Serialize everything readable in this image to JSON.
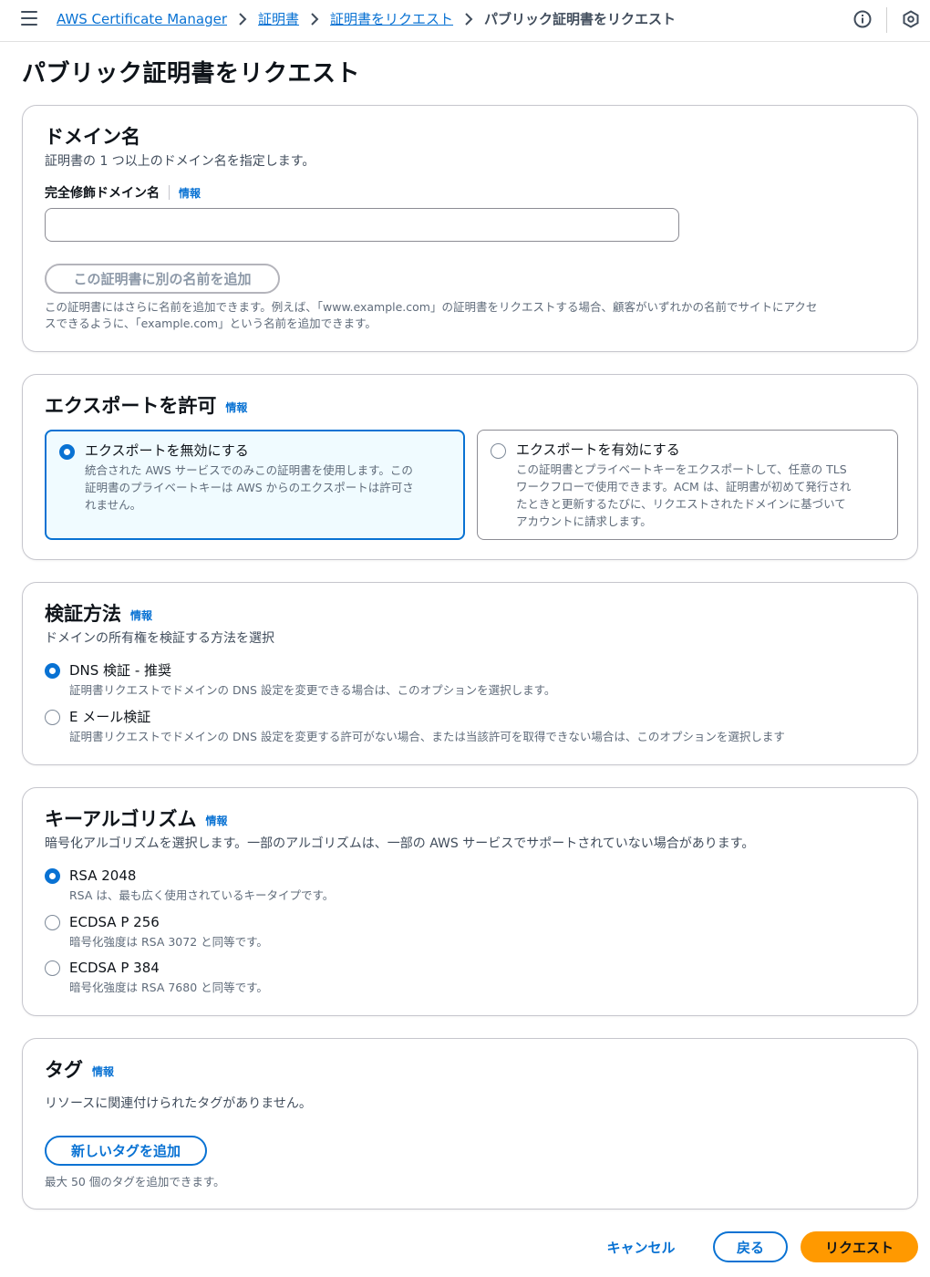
{
  "breadcrumbs": {
    "service": "AWS Certificate Manager",
    "certificates": "証明書",
    "request": "証明書をリクエスト",
    "current": "パブリック証明書をリクエスト"
  },
  "page": {
    "title": "パブリック証明書をリクエスト"
  },
  "info_label": "情報",
  "domain": {
    "title": "ドメイン名",
    "description": "証明書の 1 つ以上のドメイン名を指定します。",
    "field_label": "完全修飾ドメイン名",
    "field_value": "",
    "add_name_button": "この証明書に別の名前を追加",
    "help_line1": "この証明書にはさらに名前を追加できます。例えば、「www.example.com」の証明書をリクエストする場合、顧客がいずれかの名前でサイトにアクセ",
    "help_line2": "スできるように、「example.com」という名前を追加できます。"
  },
  "export": {
    "title": "エクスポートを許可",
    "options": [
      {
        "title": "エクスポートを無効にする",
        "desc_lines": [
          "統合された AWS サービスでのみこの証明書を使用します。この",
          "証明書のプライベートキーは AWS からのエクスポートは許可さ",
          "れません。"
        ],
        "selected": true
      },
      {
        "title": "エクスポートを有効にする",
        "desc_lines": [
          "この証明書とプライベートキーをエクスポートして、任意の TLS",
          "ワークフローで使用できます。ACM は、証明書が初めて発行され",
          "たときと更新するたびに、リクエストされたドメインに基づいて",
          "アカウントに請求します。"
        ],
        "selected": false
      }
    ]
  },
  "validation": {
    "title": "検証方法",
    "description": "ドメインの所有権を検証する方法を選択",
    "options": [
      {
        "title": "DNS 検証 - 推奨",
        "desc": "証明書リクエストでドメインの DNS 設定を変更できる場合は、このオプションを選択します。",
        "selected": true
      },
      {
        "title": "E メール検証",
        "desc": "証明書リクエストでドメインの DNS 設定を変更する許可がない場合、または当該許可を取得できない場合は、このオプションを選択します",
        "selected": false
      }
    ]
  },
  "key_algorithm": {
    "title": "キーアルゴリズム",
    "description": "暗号化アルゴリズムを選択します。一部のアルゴリズムは、一部の AWS サービスでサポートされていない場合があります。",
    "options": [
      {
        "title": "RSA 2048",
        "desc": "RSA は、最も広く使用されているキータイプです。",
        "selected": true
      },
      {
        "title": "ECDSA P 256",
        "desc": "暗号化強度は RSA 3072 と同等です。",
        "selected": false
      },
      {
        "title": "ECDSA P 384",
        "desc": "暗号化強度は RSA 7680 と同等です。",
        "selected": false
      }
    ]
  },
  "tags": {
    "title": "タグ",
    "empty_message": "リソースに関連付けられたタグがありません。",
    "add_button": "新しいタグを追加",
    "limit_note": "最大 50 個のタグを追加できます。"
  },
  "footer": {
    "cancel": "キャンセル",
    "back": "戻る",
    "submit": "リクエスト"
  },
  "colors": {
    "link": "#0972d3",
    "primary_button": "#ff9900",
    "selected_tile_bg": "#f0fbff"
  }
}
